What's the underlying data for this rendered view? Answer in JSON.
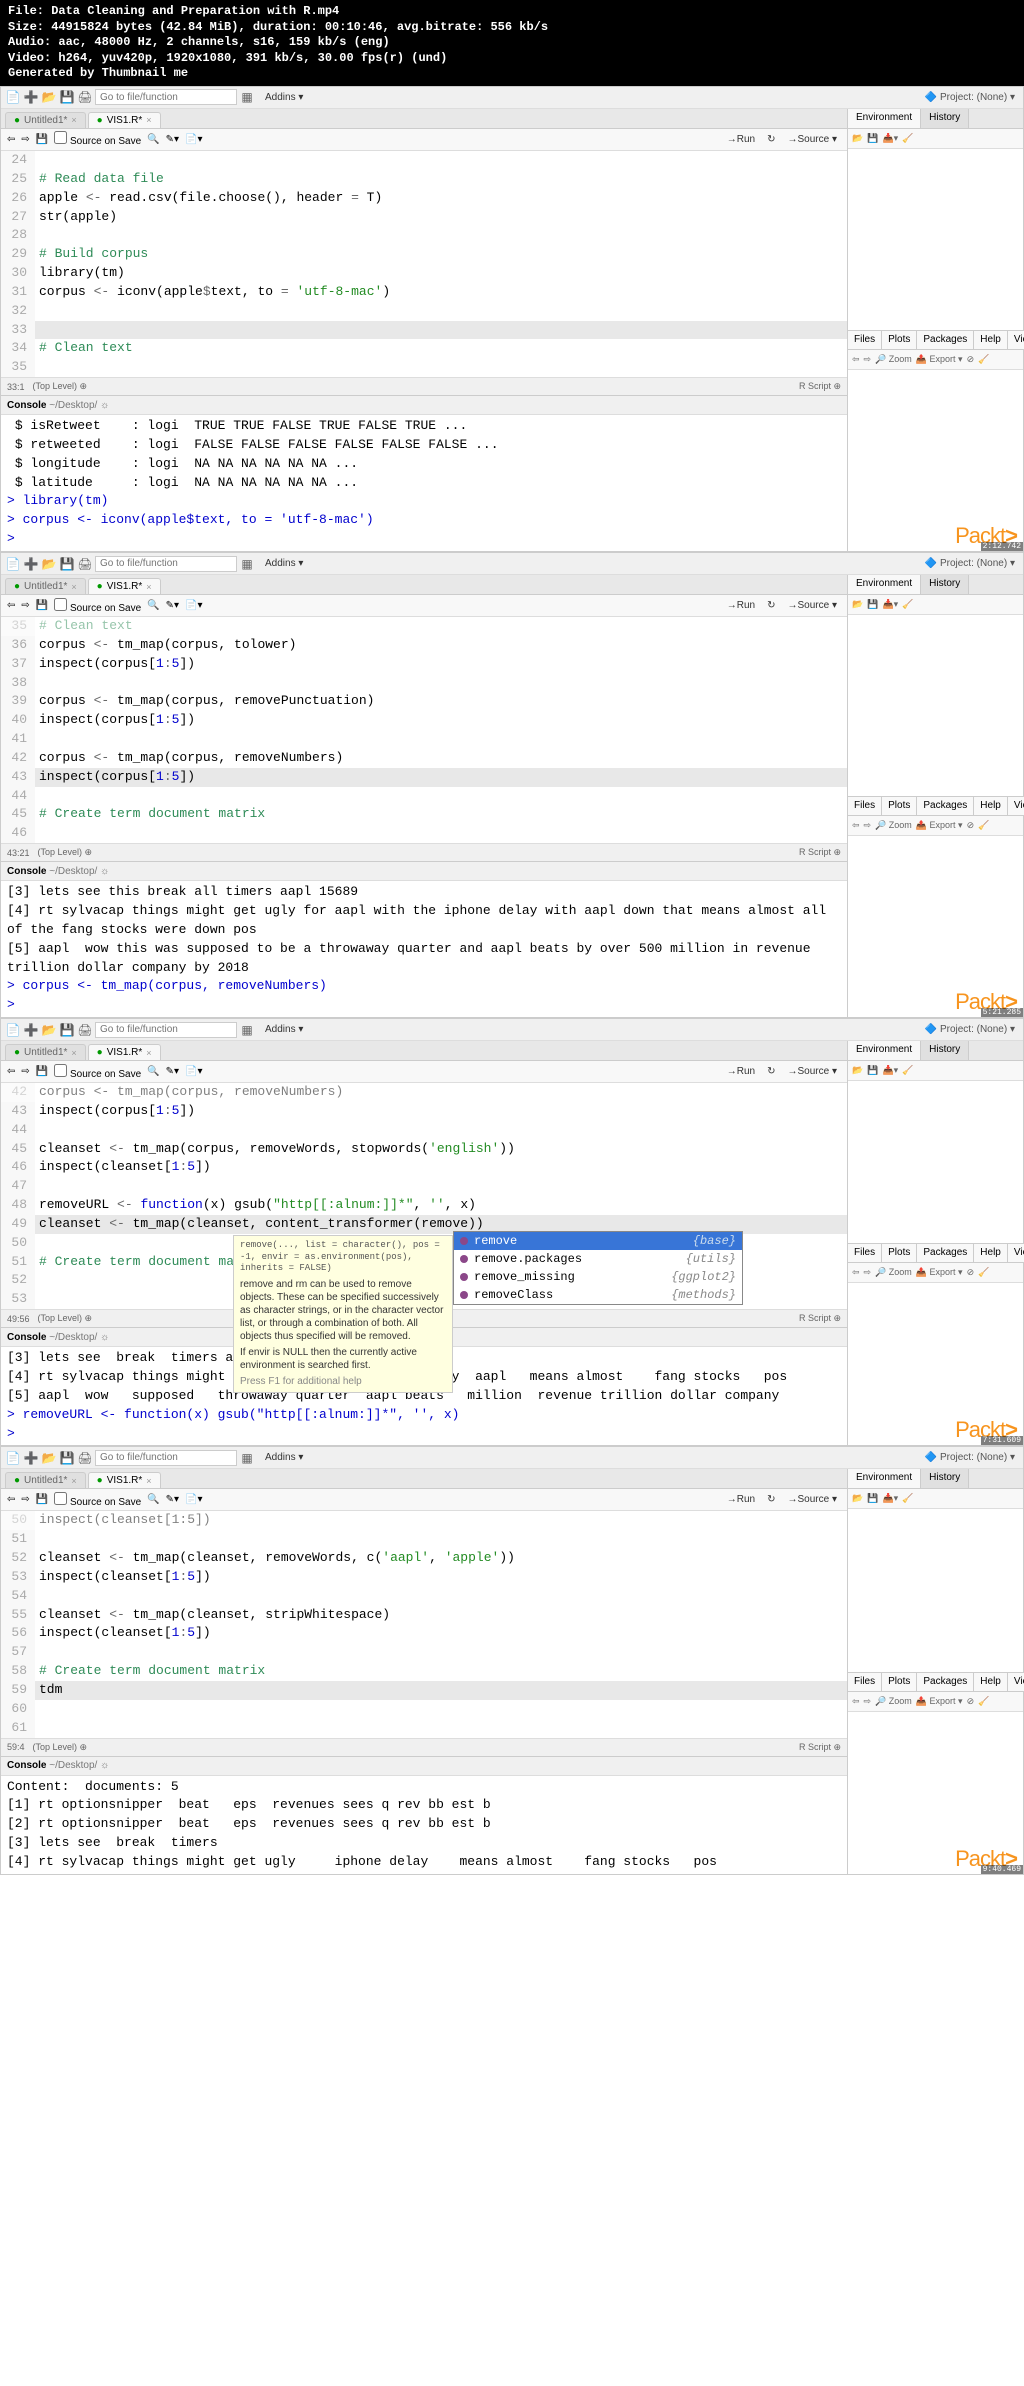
{
  "header": {
    "file": "File: Data Cleaning and Preparation with R.mp4",
    "size": "Size: 44915824 bytes (42.84 MiB), duration: 00:10:46, avg.bitrate: 556 kb/s",
    "audio": "Audio: aac, 48000 Hz, 2 channels, s16, 159 kb/s (eng)",
    "video": "Video: h264, yuv420p, 1920x1080, 391 kb/s, 30.00 fps(r) (und)",
    "gen": "Generated by Thumbnail me"
  },
  "toolbar": {
    "go_placeholder": "Go to file/function",
    "addins": "Addins ▾",
    "project": "Project: (None) ▾"
  },
  "tabs": {
    "untitled": "Untitled1*",
    "script": "VIS1.R*"
  },
  "script_toolbar": {
    "source_on_save": "Source on Save",
    "run": "→Run",
    "source": "→Source ▾"
  },
  "env_tabs": {
    "environment": "Environment",
    "history": "History"
  },
  "files_tabs": {
    "files": "Files",
    "plots": "Plots",
    "packages": "Packages",
    "help": "Help",
    "viewer": "Viewer"
  },
  "files_toolbar": {
    "zoom": "Zoom",
    "export": "Export ▾"
  },
  "editor_footer": {
    "rscript": "R Script ⊕"
  },
  "console_label": "Console",
  "console_path": "~/Desktop/",
  "packt": "Packt",
  "f1": {
    "editor": [
      {
        "n": "24",
        "code": ""
      },
      {
        "n": "25",
        "code": "# Read data file",
        "cls": "c-comment"
      },
      {
        "n": "26",
        "parts": [
          {
            "t": "apple ",
            "c": "c-id"
          },
          {
            "t": "<-",
            "c": "c-assign"
          },
          {
            "t": " read.csv(file.choose(), header ",
            "c": "c-id"
          },
          {
            "t": "=",
            "c": "c-assign"
          },
          {
            "t": " T)",
            "c": "c-id"
          }
        ]
      },
      {
        "n": "27",
        "parts": [
          {
            "t": "str(apple)",
            "c": "c-id"
          }
        ]
      },
      {
        "n": "28",
        "code": ""
      },
      {
        "n": "29",
        "code": "# Build corpus",
        "cls": "c-comment"
      },
      {
        "n": "30",
        "parts": [
          {
            "t": "library(tm)",
            "c": "c-id"
          }
        ]
      },
      {
        "n": "31",
        "parts": [
          {
            "t": "corpus ",
            "c": "c-id"
          },
          {
            "t": "<-",
            "c": "c-assign"
          },
          {
            "t": " iconv(apple",
            "c": "c-id"
          },
          {
            "t": "$",
            "c": "c-op"
          },
          {
            "t": "text, to ",
            "c": "c-id"
          },
          {
            "t": "=",
            "c": "c-assign"
          },
          {
            "t": " ",
            "c": ""
          },
          {
            "t": "'utf-8-mac'",
            "c": "c-string"
          },
          {
            "t": ")",
            "c": "c-id"
          }
        ]
      },
      {
        "n": "32",
        "code": ""
      },
      {
        "n": "33",
        "code": "",
        "hl": true
      },
      {
        "n": "34",
        "code": "# Clean text",
        "cls": "c-comment"
      },
      {
        "n": "35",
        "code": ""
      }
    ],
    "footer_pos": "33:1",
    "footer_scope": "(Top Level) ⊕",
    "console": [
      {
        "t": " $ isRetweet    : logi  TRUE TRUE FALSE TRUE FALSE TRUE ...",
        "c": "c-black"
      },
      {
        "t": " $ retweeted    : logi  FALSE FALSE FALSE FALSE FALSE FALSE ...",
        "c": "c-black"
      },
      {
        "t": " $ longitude    : logi  NA NA NA NA NA NA ...",
        "c": "c-black"
      },
      {
        "t": " $ latitude     : logi  NA NA NA NA NA NA ...",
        "c": "c-black"
      },
      {
        "t": "> library(tm)",
        "c": "c-blue"
      },
      {
        "t": "> corpus <- iconv(apple$text, to = 'utf-8-mac')",
        "c": "c-blue"
      },
      {
        "t": "> ",
        "c": "c-blue"
      }
    ],
    "ts": "2:12.742"
  },
  "f2": {
    "editor": [
      {
        "n": "35",
        "parts": [
          {
            "t": "# Clean text",
            "c": "c-comment"
          }
        ],
        "faded": true
      },
      {
        "n": "36",
        "parts": [
          {
            "t": "corpus ",
            "c": "c-id"
          },
          {
            "t": "<-",
            "c": "c-assign"
          },
          {
            "t": " tm_map(corpus, tolower)",
            "c": "c-id"
          }
        ]
      },
      {
        "n": "37",
        "parts": [
          {
            "t": "inspect(corpus[",
            "c": "c-id"
          },
          {
            "t": "1",
            "c": "c-num"
          },
          {
            "t": ":",
            "c": "c-op"
          },
          {
            "t": "5",
            "c": "c-num"
          },
          {
            "t": "])",
            "c": "c-id"
          }
        ]
      },
      {
        "n": "38",
        "code": ""
      },
      {
        "n": "39",
        "parts": [
          {
            "t": "corpus ",
            "c": "c-id"
          },
          {
            "t": "<-",
            "c": "c-assign"
          },
          {
            "t": " tm_map(corpus, removePunctuation)",
            "c": "c-id"
          }
        ]
      },
      {
        "n": "40",
        "parts": [
          {
            "t": "inspect(corpus[",
            "c": "c-id"
          },
          {
            "t": "1",
            "c": "c-num"
          },
          {
            "t": ":",
            "c": "c-op"
          },
          {
            "t": "5",
            "c": "c-num"
          },
          {
            "t": "])",
            "c": "c-id"
          }
        ]
      },
      {
        "n": "41",
        "code": ""
      },
      {
        "n": "42",
        "parts": [
          {
            "t": "corpus ",
            "c": "c-id"
          },
          {
            "t": "<-",
            "c": "c-assign"
          },
          {
            "t": " tm_map(corpus, removeNumbers)",
            "c": "c-id"
          }
        ]
      },
      {
        "n": "43",
        "parts": [
          {
            "t": "inspect(corpus[",
            "c": "c-id"
          },
          {
            "t": "1",
            "c": "c-num"
          },
          {
            "t": ":",
            "c": "c-op"
          },
          {
            "t": "5",
            "c": "c-num"
          },
          {
            "t": "])",
            "c": "c-id"
          }
        ],
        "hl": true
      },
      {
        "n": "44",
        "code": ""
      },
      {
        "n": "45",
        "code": "# Create term document matrix",
        "cls": "c-comment"
      },
      {
        "n": "46",
        "code": ""
      }
    ],
    "footer_pos": "43:21",
    "footer_scope": "(Top Level) ⊕",
    "console": [
      {
        "t": "[3] lets see this break all timers aapl 15689",
        "c": "c-black"
      },
      {
        "t": "[4] rt sylvacap things might get ugly for aapl with the iphone delay with aapl down that means almost all of the fang stocks were down pos",
        "c": "c-black"
      },
      {
        "t": "[5] aapl  wow this was supposed to be a throwaway quarter and aapl beats by over 500 million in revenue trillion dollar company by 2018",
        "c": "c-black"
      },
      {
        "t": "> corpus <- tm_map(corpus, removeNumbers)",
        "c": "c-blue"
      },
      {
        "t": "> ",
        "c": "c-blue"
      }
    ],
    "ts": "5:21.285"
  },
  "f3": {
    "editor": [
      {
        "n": "42",
        "parts": [
          {
            "t": "corpus <- tm_map(corpus, removeNumbers)",
            "c": "c-id"
          }
        ],
        "faded": true
      },
      {
        "n": "43",
        "parts": [
          {
            "t": "inspect(corpus[",
            "c": "c-id"
          },
          {
            "t": "1",
            "c": "c-num"
          },
          {
            "t": ":",
            "c": "c-op"
          },
          {
            "t": "5",
            "c": "c-num"
          },
          {
            "t": "])",
            "c": "c-id"
          }
        ]
      },
      {
        "n": "44",
        "code": ""
      },
      {
        "n": "45",
        "parts": [
          {
            "t": "cleanset ",
            "c": "c-id"
          },
          {
            "t": "<-",
            "c": "c-assign"
          },
          {
            "t": " tm_map(corpus, removeWords, stopwords(",
            "c": "c-id"
          },
          {
            "t": "'english'",
            "c": "c-string"
          },
          {
            "t": "))",
            "c": "c-id"
          }
        ]
      },
      {
        "n": "46",
        "parts": [
          {
            "t": "inspect(cleanset[",
            "c": "c-id"
          },
          {
            "t": "1",
            "c": "c-num"
          },
          {
            "t": ":",
            "c": "c-op"
          },
          {
            "t": "5",
            "c": "c-num"
          },
          {
            "t": "])",
            "c": "c-id"
          }
        ]
      },
      {
        "n": "47",
        "code": ""
      },
      {
        "n": "48",
        "parts": [
          {
            "t": "removeURL ",
            "c": "c-id"
          },
          {
            "t": "<-",
            "c": "c-assign"
          },
          {
            "t": " ",
            "c": ""
          },
          {
            "t": "function",
            "c": "c-keyword"
          },
          {
            "t": "(x) gsub(",
            "c": "c-id"
          },
          {
            "t": "\"http[[:alnum:]]*\"",
            "c": "c-string"
          },
          {
            "t": ", ",
            "c": "c-id"
          },
          {
            "t": "''",
            "c": "c-string"
          },
          {
            "t": ", x)",
            "c": "c-id"
          }
        ]
      },
      {
        "n": "49",
        "parts": [
          {
            "t": "cleanset ",
            "c": "c-id"
          },
          {
            "t": "<-",
            "c": "c-assign"
          },
          {
            "t": " tm_map(cleanset, content_transformer(remove))",
            "c": "c-id"
          }
        ],
        "hl": true
      },
      {
        "n": "50",
        "code": ""
      },
      {
        "n": "51",
        "code": "# Create term document matrix",
        "cls": "c-comment"
      },
      {
        "n": "52",
        "code": ""
      },
      {
        "n": "53",
        "code": ""
      }
    ],
    "footer_pos": "49:56",
    "footer_scope": "(Top Level) ⊕",
    "console": [
      {
        "t": "[3] lets see  break  timers aapl",
        "c": "c-black"
      },
      {
        "t": "[4] rt sylvacap things might get ugly  aapl   iphone delay  aapl   means almost    fang stocks   pos",
        "c": "c-black"
      },
      {
        "t": "[5] aapl  wow   supposed   throwaway quarter  aapl beats   million  revenue trillion dollar company",
        "c": "c-black"
      },
      {
        "t": "> removeURL <- function(x) gsub(\"http[[:alnum:]]*\", '', x)",
        "c": "c-blue"
      },
      {
        "t": "> ",
        "c": "c-blue"
      }
    ],
    "tooltip": {
      "sig": "remove(..., list = character(), pos = -1, envir = as.environment(pos), inherits = FALSE)",
      "desc": "remove and rm can be used to remove objects. These can be specified successively as character strings, or in the character vector list, or through a combination of both. All objects thus specified will be removed.",
      "desc2": "If envir is NULL then the currently active environment is searched first.",
      "hint": "Press F1 for additional help"
    },
    "autocomplete": [
      {
        "label": "remove",
        "pkg": "{base}",
        "sel": true
      },
      {
        "label": "remove.packages",
        "pkg": "{utils}"
      },
      {
        "label": "remove_missing",
        "pkg": "{ggplot2}"
      },
      {
        "label": "removeClass",
        "pkg": "{methods}"
      }
    ],
    "ts": "7:31.609"
  },
  "f4": {
    "editor": [
      {
        "n": "50",
        "parts": [
          {
            "t": "inspect(cleanset[1:5])",
            "c": "c-id"
          }
        ],
        "faded": true
      },
      {
        "n": "51",
        "code": ""
      },
      {
        "n": "52",
        "parts": [
          {
            "t": "cleanset ",
            "c": "c-id"
          },
          {
            "t": "<-",
            "c": "c-assign"
          },
          {
            "t": " tm_map(cleanset, removeWords, c(",
            "c": "c-id"
          },
          {
            "t": "'aapl'",
            "c": "c-string"
          },
          {
            "t": ", ",
            "c": "c-id"
          },
          {
            "t": "'apple'",
            "c": "c-string"
          },
          {
            "t": "))",
            "c": "c-id"
          }
        ]
      },
      {
        "n": "53",
        "parts": [
          {
            "t": "inspect(cleanset[",
            "c": "c-id"
          },
          {
            "t": "1",
            "c": "c-num"
          },
          {
            "t": ":",
            "c": "c-op"
          },
          {
            "t": "5",
            "c": "c-num"
          },
          {
            "t": "])",
            "c": "c-id"
          }
        ]
      },
      {
        "n": "54",
        "code": ""
      },
      {
        "n": "55",
        "parts": [
          {
            "t": "cleanset ",
            "c": "c-id"
          },
          {
            "t": "<-",
            "c": "c-assign"
          },
          {
            "t": " tm_map(cleanset, stripWhitespace)",
            "c": "c-id"
          }
        ]
      },
      {
        "n": "56",
        "parts": [
          {
            "t": "inspect(cleanset[",
            "c": "c-id"
          },
          {
            "t": "1",
            "c": "c-num"
          },
          {
            "t": ":",
            "c": "c-op"
          },
          {
            "t": "5",
            "c": "c-num"
          },
          {
            "t": "])",
            "c": "c-id"
          }
        ]
      },
      {
        "n": "57",
        "code": ""
      },
      {
        "n": "58",
        "code": "# Create term document matrix",
        "cls": "c-comment"
      },
      {
        "n": "59",
        "parts": [
          {
            "t": "tdm",
            "c": "c-id"
          }
        ],
        "hl": true
      },
      {
        "n": "60",
        "code": ""
      },
      {
        "n": "61",
        "code": ""
      }
    ],
    "footer_pos": "59:4",
    "footer_scope": "(Top Level) ⊕",
    "console": [
      {
        "t": "Content:  documents: 5",
        "c": "c-black"
      },
      {
        "t": "",
        "c": "c-black"
      },
      {
        "t": "[1] rt optionsnipper  beat   eps  revenues sees q rev bb est b",
        "c": "c-black"
      },
      {
        "t": "[2] rt optionsnipper  beat   eps  revenues sees q rev bb est b",
        "c": "c-black"
      },
      {
        "t": "[3] lets see  break  timers",
        "c": "c-black"
      },
      {
        "t": "[4] rt sylvacap things might get ugly     iphone delay    means almost    fang stocks   pos",
        "c": "c-black"
      }
    ],
    "ts": "9:40.469"
  }
}
